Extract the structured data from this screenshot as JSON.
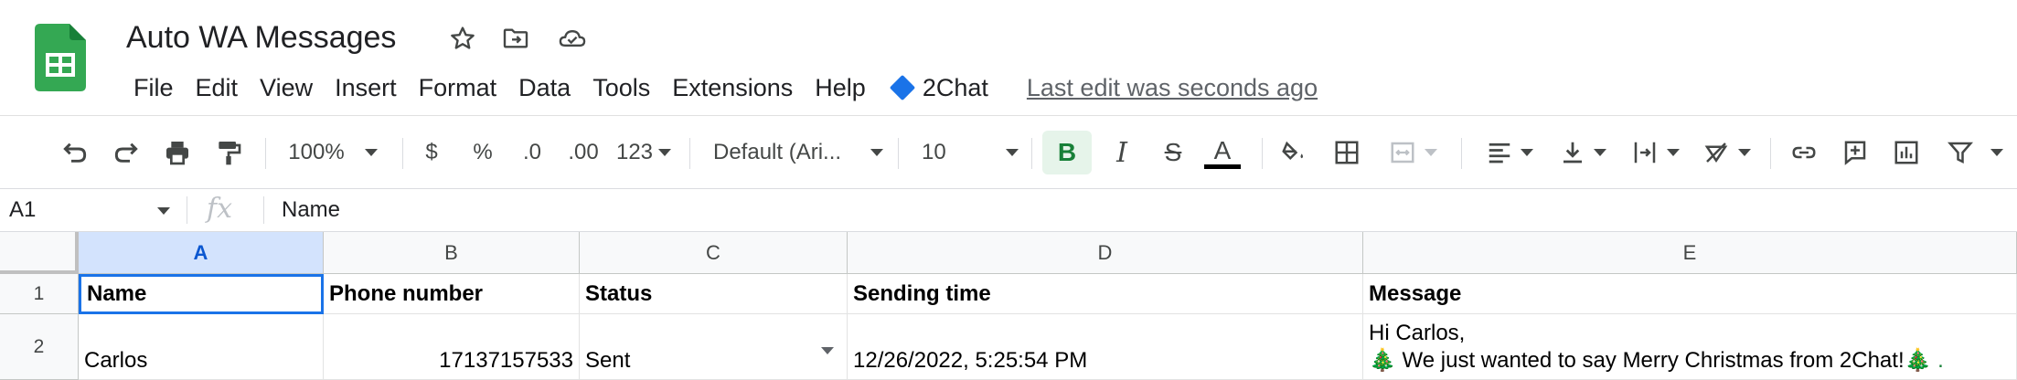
{
  "app": {
    "title": "Auto WA Messages",
    "logo_icon": "google-sheets-icon",
    "title_icons": [
      "star-icon",
      "move-to-folder-icon",
      "cloud-saved-icon"
    ],
    "menu": [
      "File",
      "Edit",
      "View",
      "Insert",
      "Format",
      "Data",
      "Tools",
      "Extensions",
      "Help"
    ],
    "addon": {
      "label": "2Chat",
      "icon": "blue-diamond-icon",
      "color": "#1a73e8"
    },
    "last_edit": "Last edit was seconds ago"
  },
  "toolbar": {
    "zoom": "100%",
    "currency": "$",
    "percent": "%",
    "decrease_decimal": ".0",
    "increase_decimal": ".00",
    "more_formats": "123",
    "font": "Default (Ari...",
    "font_size": "10",
    "bold_label": "B",
    "italic_label": "I",
    "strike_label": "S",
    "text_color_label": "A",
    "bold_active_color": "#e6f4ea"
  },
  "formula_bar": {
    "cell_ref": "A1",
    "fx_label": "fx",
    "value": "Name"
  },
  "sheet": {
    "columns": [
      "A",
      "B",
      "C",
      "D",
      "E"
    ],
    "rows": [
      "1",
      "2"
    ],
    "header_row": [
      "Name",
      "Phone number",
      "Status",
      "Sending time",
      "Message"
    ],
    "data_row": {
      "name": "Carlos",
      "phone": "17137157533",
      "status": "Sent",
      "sending_time": "12/26/2022, 5:25:54 PM",
      "message_line1": "Hi Carlos,",
      "message_line2_prefix": "🎄",
      "message_line2_text": " We just wanted to say Merry Christmas from 2Chat!",
      "message_line2_suffix": "🎄 ."
    },
    "selection_color": "#1a73e8"
  }
}
